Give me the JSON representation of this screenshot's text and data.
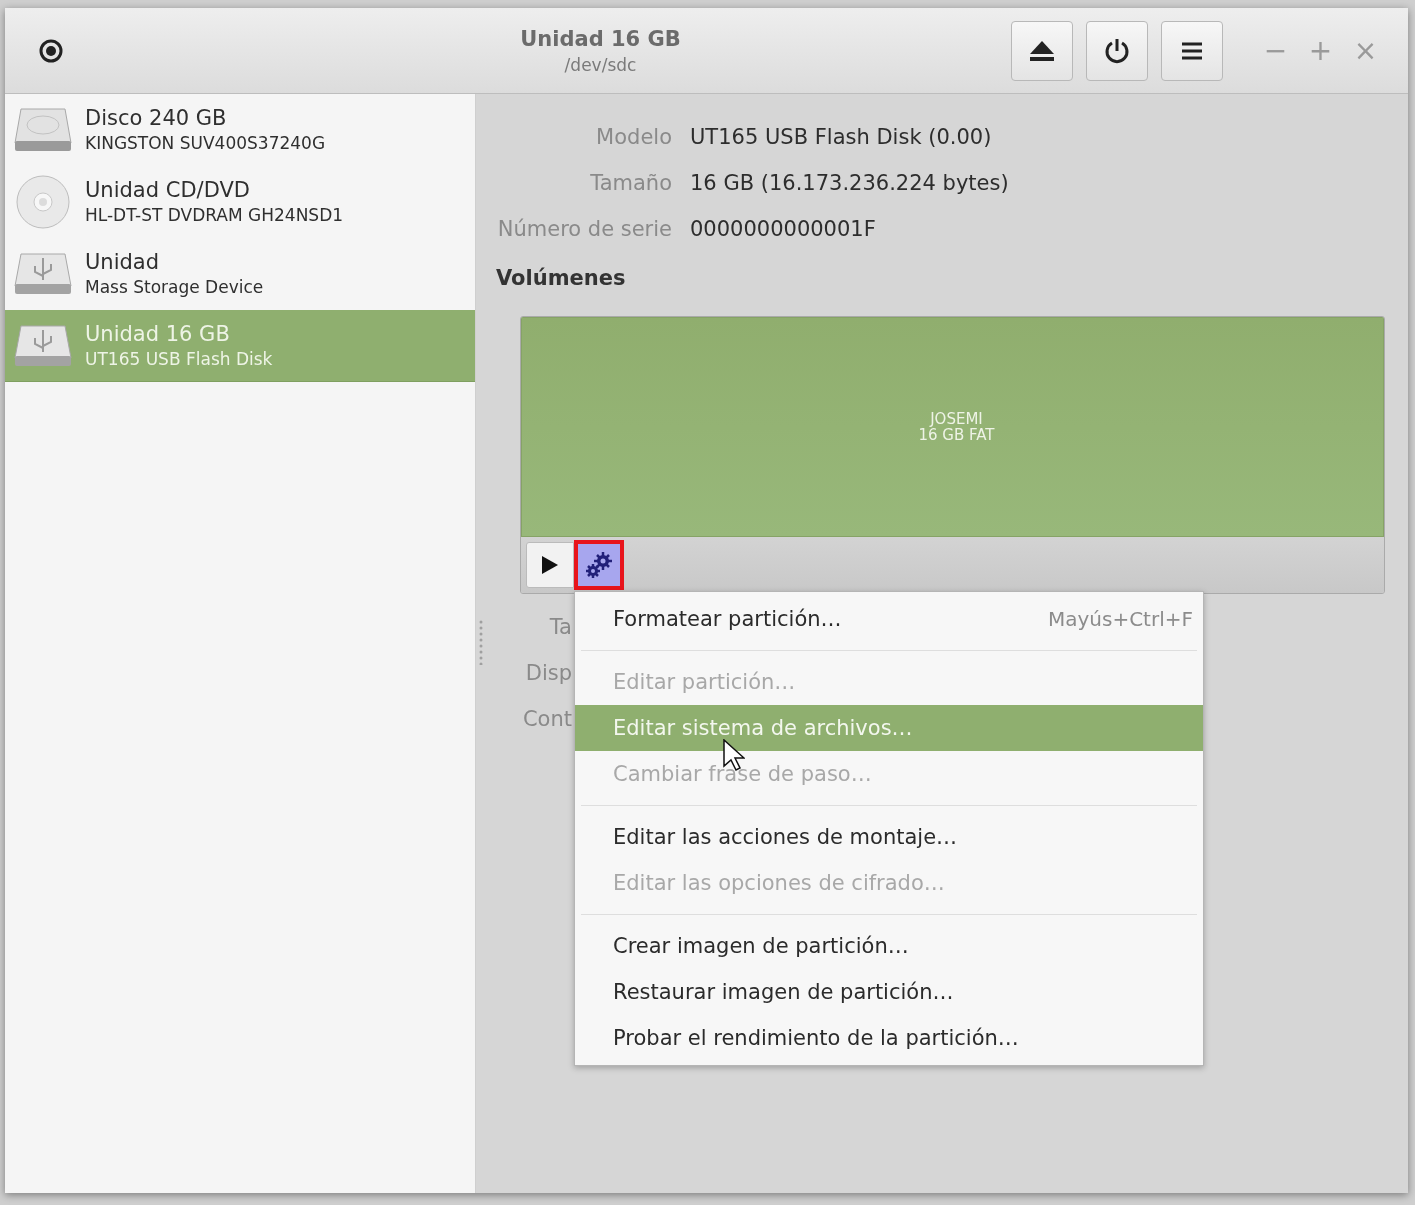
{
  "window": {
    "title": "Unidad 16 GB",
    "subtitle": "/dev/sdc",
    "controls": [
      "−",
      "+",
      "×"
    ]
  },
  "sidebar": {
    "items": [
      {
        "kind": "disk",
        "title": "Disco 240 GB",
        "subtitle": "KINGSTON SUV400S37240G",
        "selected": false
      },
      {
        "kind": "optical",
        "title": "Unidad CD/DVD",
        "subtitle": "HL-DT-ST DVDRAM GH24NSD1",
        "selected": false
      },
      {
        "kind": "usb",
        "title": "Unidad",
        "subtitle": "Mass Storage Device",
        "selected": false
      },
      {
        "kind": "usb",
        "title": "Unidad 16 GB",
        "subtitle": "UT165 USB Flash Disk",
        "selected": true
      }
    ]
  },
  "details": [
    {
      "label": "Modelo",
      "value": "UT165 USB Flash Disk (0.00)"
    },
    {
      "label": "Tamaño",
      "value": "16 GB (16.173.236.224 bytes)"
    },
    {
      "label": "Número de serie",
      "value": "0000000000001F"
    }
  ],
  "volumes": {
    "heading": "Volúmenes",
    "partition": {
      "name": "JOSEMI",
      "info": "16 GB FAT",
      "selected": true
    },
    "partition_labels": [
      "Ta",
      "Disp",
      "Cont"
    ]
  },
  "menu": {
    "items": [
      {
        "kind": "item",
        "label": "Formatear partición…",
        "shortcut": "Mayús+Ctrl+F",
        "disabled": false,
        "selected": false
      },
      {
        "kind": "separator"
      },
      {
        "kind": "item",
        "label": "Editar partición…",
        "disabled": true,
        "selected": false
      },
      {
        "kind": "item",
        "label": "Editar sistema de archivos…",
        "disabled": false,
        "selected": true
      },
      {
        "kind": "item",
        "label": "Cambiar frase de paso…",
        "disabled": true,
        "selected": false
      },
      {
        "kind": "separator"
      },
      {
        "kind": "item",
        "label": "Editar las acciones de montaje…",
        "disabled": false,
        "selected": false
      },
      {
        "kind": "item",
        "label": "Editar las opciones de cifrado…",
        "disabled": true,
        "selected": false
      },
      {
        "kind": "separator"
      },
      {
        "kind": "item",
        "label": "Crear imagen de partición…",
        "disabled": false,
        "selected": false
      },
      {
        "kind": "item",
        "label": "Restaurar imagen de partición…",
        "disabled": false,
        "selected": false
      },
      {
        "kind": "item",
        "label": "Probar el rendimiento de la partición…",
        "disabled": false,
        "selected": false
      }
    ]
  }
}
